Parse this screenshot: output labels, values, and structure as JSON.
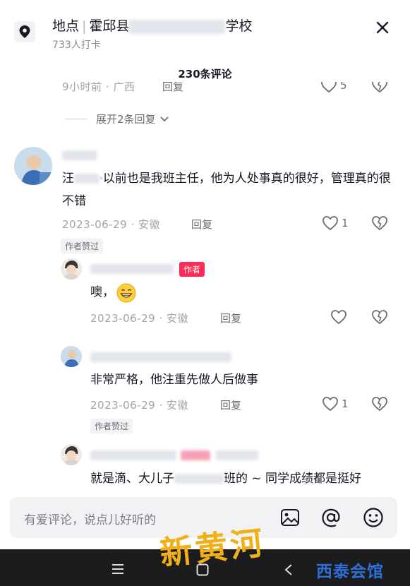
{
  "header": {
    "label": "地点",
    "county": "霍邱县",
    "suffix": "学校",
    "checkins": "733人打卡"
  },
  "comment_count": "230条评论",
  "prev": {
    "time": "9小时前 · 广西",
    "reply": "回复",
    "likes": "5"
  },
  "expand_label": "展开2条回复",
  "comments": [
    {
      "text_a": "汪",
      "text_b": "以前也是我班主任，他为人处事真的很好，管理真的很不错",
      "meta": "2023-06-29 · 安徽",
      "reply": "回复",
      "likes": "1",
      "badge": "作者赞过"
    }
  ],
  "replies": [
    {
      "author_badge": "作者",
      "text": "噢，",
      "emoji": "😁",
      "meta": "2023-06-29 · 安徽",
      "reply": "回复"
    },
    {
      "text": "非常严格，他注重先做人后做事",
      "meta": "2023-06-29 · 安徽",
      "reply": "回复",
      "likes": "1",
      "badge": "作者赞过"
    },
    {
      "text_a": "就是滴、大儿子",
      "text_b": "班的 ~ 同学成绩都是挺好"
    }
  ],
  "input": {
    "placeholder": "有爱评论，说点儿好听的"
  },
  "icons": [
    "location-pin-icon",
    "close-icon",
    "heart-icon",
    "broken-heart-icon",
    "chevron-down-icon",
    "image-icon",
    "at-icon",
    "emoji-icon",
    "menu-icon",
    "home-square-icon",
    "back-icon"
  ],
  "watermarks": {
    "logo_main": "新黄河",
    "logo_corner": "西泰会馆"
  }
}
